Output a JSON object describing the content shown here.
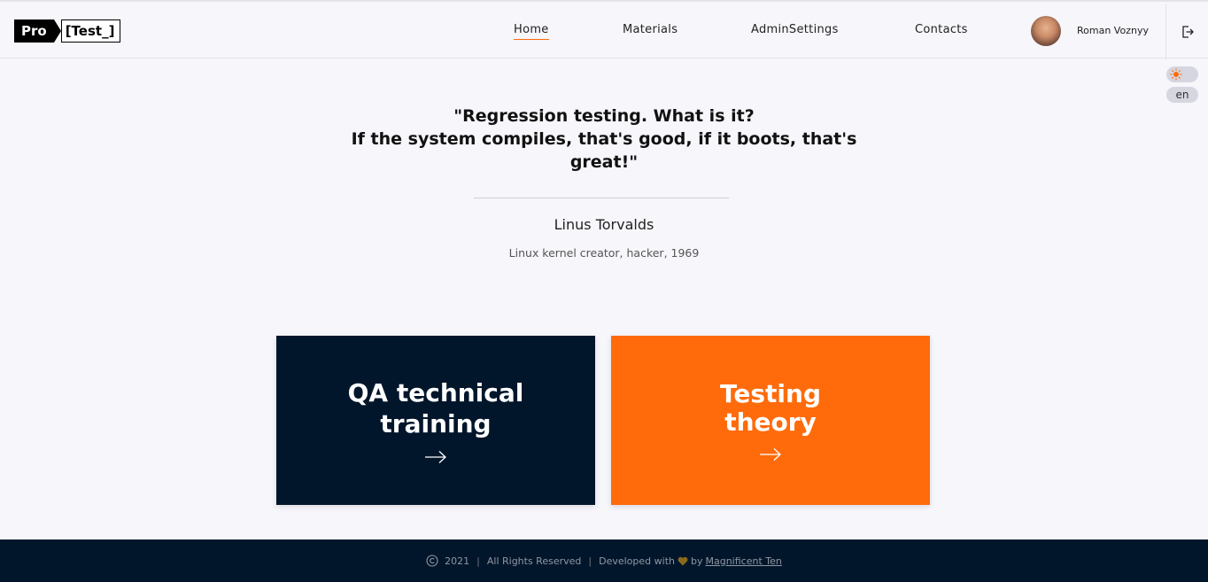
{
  "header": {
    "logo_pro": "Pro",
    "logo_test": "[Test_]",
    "nav": [
      {
        "label": "Home",
        "active": true
      },
      {
        "label": "Materials",
        "active": false
      },
      {
        "label": "AdminSettings",
        "active": false
      },
      {
        "label": "Contacts",
        "active": false
      }
    ],
    "user_name": "Roman Voznyy",
    "logout_icon": "logout-icon"
  },
  "controls": {
    "theme_icon": "sun-icon",
    "language": "en"
  },
  "quote": {
    "line1": "\"Regression testing. What is it?",
    "line2": "If the system compiles, that's good, if it boots, that's",
    "line3": "great!\"",
    "author": "Linus Torvalds",
    "author_description": "Linux kernel creator, hacker, 1969"
  },
  "cards": [
    {
      "title_line1": "QA technical",
      "title_line2": "training",
      "color": "#02162b",
      "icon": "arrow-right-icon"
    },
    {
      "title_line1": "Testing",
      "title_line2": "theory",
      "color": "#ff6b0b",
      "icon": "arrow-right-icon"
    }
  ],
  "footer": {
    "copyright_icon": "copyright-icon",
    "year": "2021",
    "rights": "All Rights Reserved",
    "developed_with": "Developed with",
    "heart_icon": "heart-icon",
    "by": "by",
    "team": "Magnificent Ten"
  },
  "colors": {
    "accent": "#ff6b0b",
    "dark": "#02162b",
    "background": "#f6f6fb"
  }
}
